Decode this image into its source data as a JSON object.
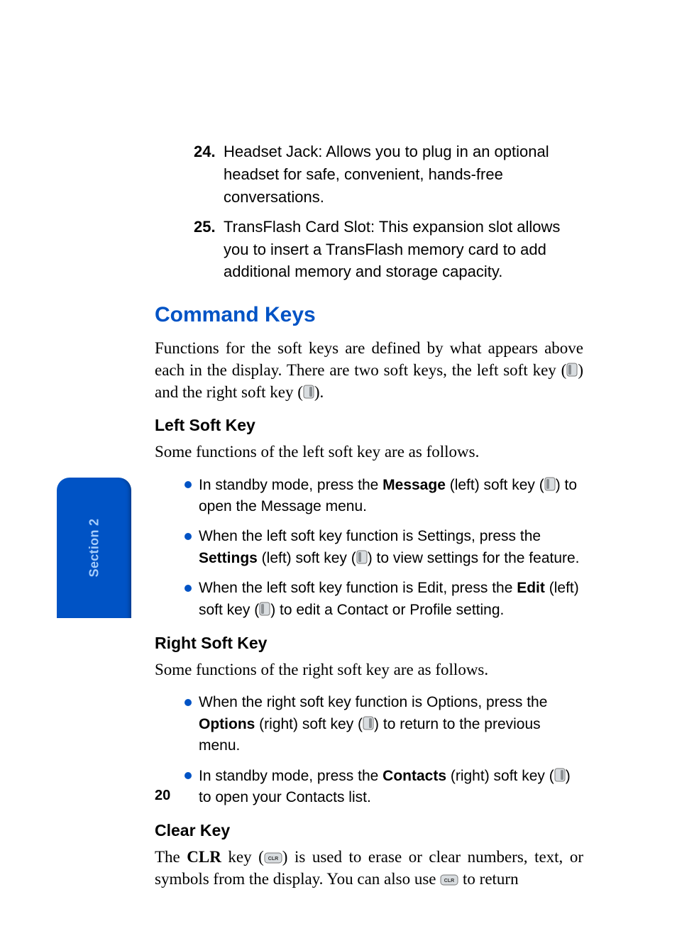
{
  "sideTab": {
    "label": "Section 2"
  },
  "pageNumber": "20",
  "numbered": {
    "items": [
      {
        "num": "24.",
        "text": "Headset Jack: Allows you to plug in an optional headset for safe, convenient, hands-free conversations."
      },
      {
        "num": "25.",
        "text": "TransFlash Card Slot: This expansion slot allows you to insert a TransFlash memory card to add additional memory and storage capacity."
      }
    ]
  },
  "heading": "Command Keys",
  "intro": {
    "prefix": "Functions for the soft keys are defined by what appears above each in the display. There are two soft keys, the left soft key (",
    "mid": ") and the right soft key (",
    "suffix": ")."
  },
  "leftSoftKey": {
    "heading": "Left Soft Key",
    "para": "Some functions of the left soft key are as follows.",
    "items": [
      {
        "pre": "In standby mode, press the ",
        "bold": "Message",
        "mid": " (left) soft key (",
        "post": ") to open the Message menu."
      },
      {
        "pre": "When the left soft key function is Settings, press the ",
        "bold": "Settings",
        "mid": " (left) soft key (",
        "post": ") to view settings for the feature."
      },
      {
        "pre": "When the left soft key function is Edit, press the ",
        "bold": "Edit",
        "mid": " (left) soft key (",
        "post": ") to edit a Contact or Profile setting."
      }
    ]
  },
  "rightSoftKey": {
    "heading": "Right Soft Key",
    "para": "Some functions of the right soft key are as follows.",
    "items": [
      {
        "pre": "When the right soft key function is Options, press the ",
        "bold": "Options",
        "mid": " (right) soft key (",
        "post": ") to return to the previous menu."
      },
      {
        "pre": "In standby mode, press the ",
        "bold": "Contacts",
        "mid": " (right) soft key (",
        "post": ") to open your Contacts list."
      }
    ]
  },
  "clearKey": {
    "heading": "Clear Key",
    "pre": "The ",
    "bold": "CLR",
    "mid1": " key (",
    "mid2": ") is used to erase or clear numbers, text, or symbols from the display. You can also use ",
    "suffix": " to return"
  }
}
